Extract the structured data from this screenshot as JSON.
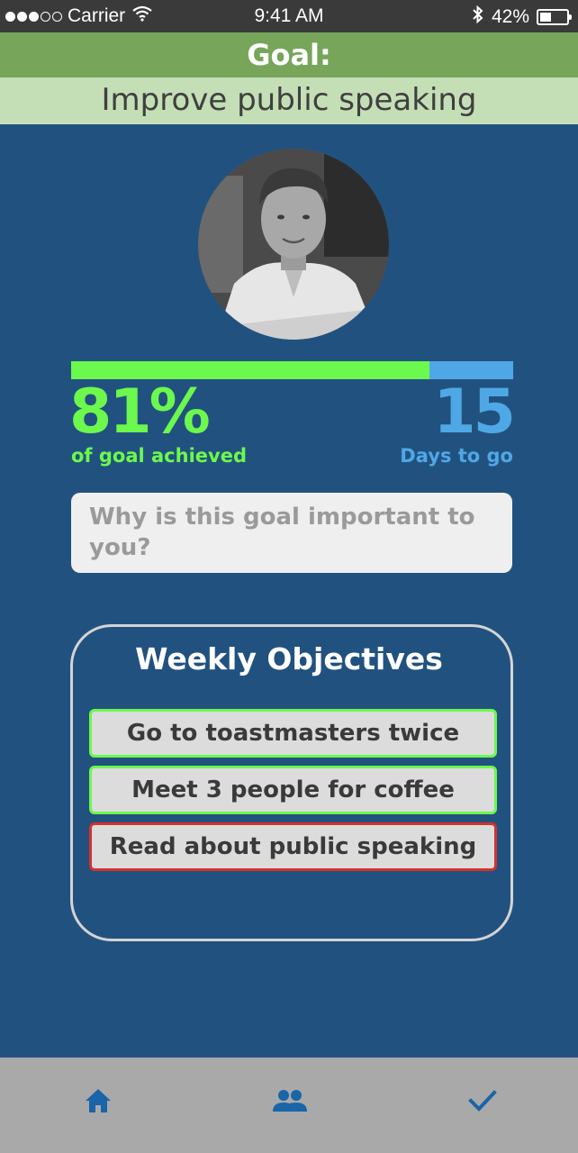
{
  "status_bar": {
    "carrier": "Carrier",
    "time": "9:41 AM",
    "battery": "42%"
  },
  "goal": {
    "heading": "Goal:",
    "title": "Improve public speaking"
  },
  "progress": {
    "percent_fraction": 0.81,
    "percent_label": "81%",
    "percent_caption": "of goal achieved",
    "days_value": "15",
    "days_caption": "Days to go"
  },
  "why": {
    "placeholder": "Why is this goal important to you?"
  },
  "objectives": {
    "title": "Weekly Objectives",
    "items": [
      {
        "label": "Go to toastmasters twice",
        "status": "done"
      },
      {
        "label": "Meet 3 people for coffee",
        "status": "done"
      },
      {
        "label": "Read about public speaking",
        "status": "pending"
      }
    ]
  },
  "tab_bar": {
    "items": [
      {
        "icon": "home-icon"
      },
      {
        "icon": "people-icon"
      },
      {
        "icon": "check-icon"
      }
    ]
  },
  "colors": {
    "background": "#21527f",
    "header_green": "#77a65b",
    "subheader_green": "#c4dfb6",
    "achieved_green": "#6cf84d",
    "days_blue": "#4fa8e6",
    "pending_red": "#d3322c",
    "tab_icon_blue": "#1a64a8"
  }
}
